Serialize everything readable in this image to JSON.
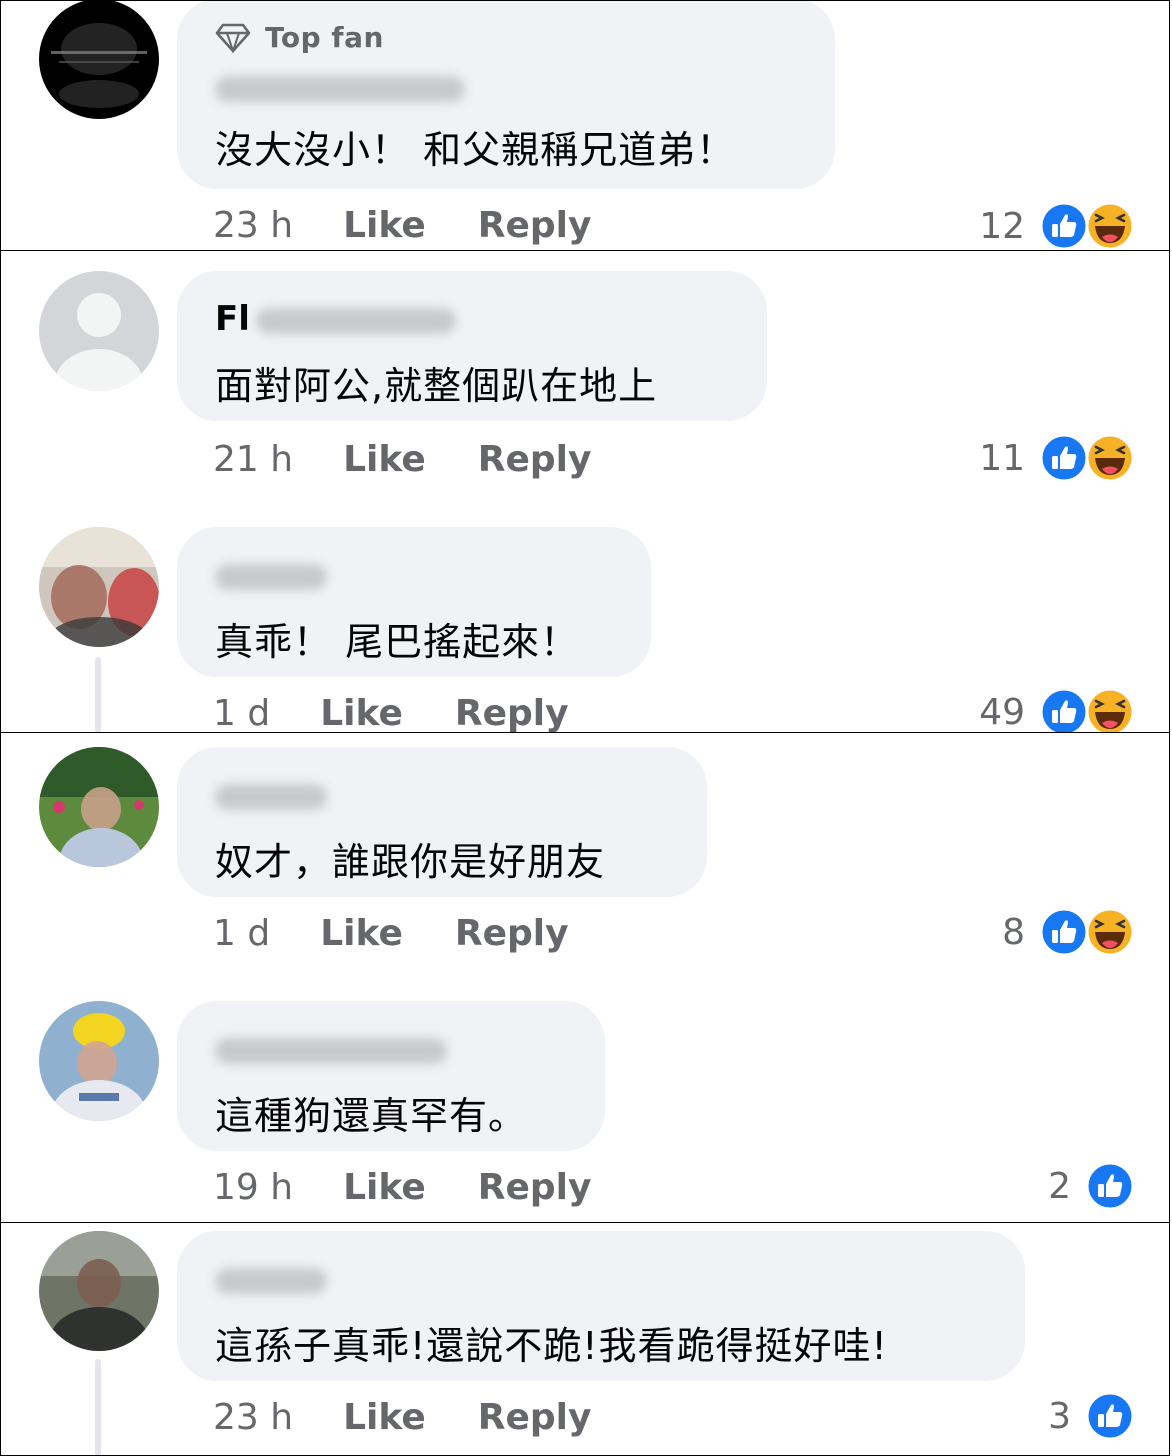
{
  "comments": [
    {
      "badge": "Top fan",
      "name_visible": "",
      "text": "沒大沒小！ 和父親稱兄道弟！",
      "time": "23 h",
      "like_label": "Like",
      "reply_label": "Reply",
      "reaction_count": "12",
      "reactions": [
        "like-icon",
        "haha-icon"
      ]
    },
    {
      "name_visible": "Fl",
      "text": "面對阿公,就整個趴在地上",
      "time": "21 h",
      "like_label": "Like",
      "reply_label": "Reply",
      "reaction_count": "11",
      "reactions": [
        "like-icon",
        "haha-icon"
      ]
    },
    {
      "name_visible": "",
      "text": "真乖！ 尾巴搖起來！",
      "time": "1 d",
      "like_label": "Like",
      "reply_label": "Reply",
      "reaction_count": "49",
      "reactions": [
        "like-icon",
        "haha-icon"
      ]
    },
    {
      "name_visible": "",
      "text": "奴才，誰跟你是好朋友",
      "time": "1 d",
      "like_label": "Like",
      "reply_label": "Reply",
      "reaction_count": "8",
      "reactions": [
        "like-icon",
        "haha-icon"
      ]
    },
    {
      "name_visible": "",
      "text": "這種狗還真罕有。",
      "time": "19 h",
      "like_label": "Like",
      "reply_label": "Reply",
      "reaction_count": "2",
      "reactions": [
        "like-icon"
      ]
    },
    {
      "name_visible": "",
      "text": "這孫子真乖!還說不跪!我看跪得挺好哇!",
      "time": "23 h",
      "like_label": "Like",
      "reply_label": "Reply",
      "reaction_count": "3",
      "reactions": [
        "like-icon"
      ]
    }
  ],
  "colors": {
    "like_blue": "#1877f2",
    "haha_yellow": "#f7b125",
    "bubble_bg": "#f0f2f5",
    "meta_gray": "#65676b"
  }
}
